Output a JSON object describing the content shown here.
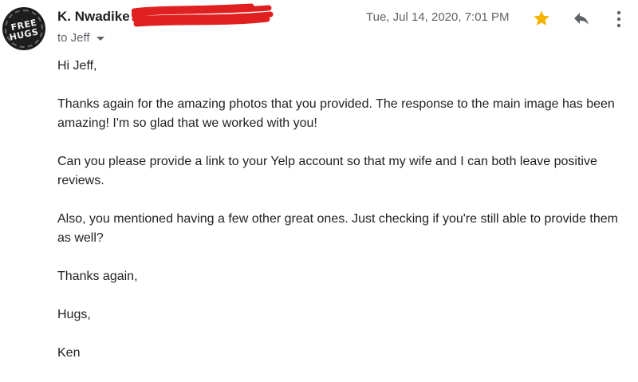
{
  "email": {
    "sender_name": "K. Nwadike",
    "recipient_line": "to Jeff",
    "date": "Tue, Jul 14, 2020, 7:01 PM",
    "avatar_text": [
      "FREE",
      "HUGS"
    ],
    "starred": true,
    "colors": {
      "star": "#f4b400",
      "redaction": "#e02020",
      "secondary_text": "#5f6368"
    },
    "icons": [
      "star-icon",
      "reply-icon",
      "more-vert-icon",
      "chevron-down-icon"
    ],
    "body": {
      "greeting": "Hi Jeff,",
      "p1": "Thanks again for the amazing photos that you provided. The response to the main image has been amazing! I'm so glad that we worked with you!",
      "p2": "Can you please provide a link to your Yelp account so that my wife and I can both leave positive reviews.",
      "p3": "Also, you mentioned having a few other great ones. Just checking if you're still able to provide them as well?",
      "closing1": "Thanks again,",
      "closing2": "Hugs,",
      "signature": "Ken"
    }
  }
}
